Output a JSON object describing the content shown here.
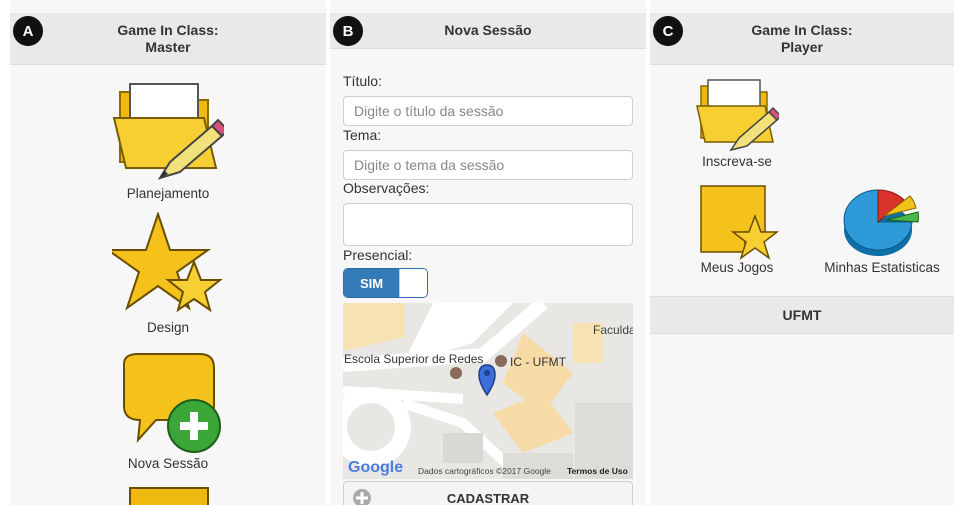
{
  "panels": {
    "a": {
      "badge": "A",
      "header_line1": "Game In Class:",
      "header_line2": "Master",
      "items": [
        {
          "label": "Planejamento",
          "icon": "folder-pencil-icon"
        },
        {
          "label": "Design",
          "icon": "stars-icon"
        },
        {
          "label": "Nova Sessão",
          "icon": "speech-bubble-plus-icon"
        },
        {
          "label": "",
          "icon": "folder-icon"
        }
      ]
    },
    "b": {
      "badge": "B",
      "header": "Nova Sessão",
      "titulo_label": "Título:",
      "titulo_placeholder": "Digite o título da sessão",
      "tema_label": "Tema:",
      "tema_placeholder": "Digite o tema da sessão",
      "obs_label": "Observações:",
      "presencial_label": "Presencial:",
      "toggle_on": "SIM",
      "map": {
        "place1": "Faculda",
        "place2": "Escola Superior de Redes",
        "place3": "IC - UFMT",
        "logo": "Google",
        "attribution": "Dados cartográficos ©2017 Google",
        "terms": "Termos de Uso"
      },
      "submit_label": "CADASTRAR"
    },
    "c": {
      "badge": "C",
      "header_line1": "Game In Class:",
      "header_line2": "Player",
      "items": [
        {
          "label": "Inscreva-se",
          "icon": "folder-pencil-icon"
        },
        {
          "label": "Meus Jogos",
          "icon": "note-star-icon"
        },
        {
          "label": "Minhas Estatisticas",
          "icon": "pie-chart-icon"
        }
      ],
      "footer": "UFMT"
    }
  },
  "colors": {
    "accent": "#337ab7",
    "header_bg": "#e9e9e9",
    "panel_bg": "#f7f7f7",
    "icon_yellow": "#f4c21a"
  }
}
